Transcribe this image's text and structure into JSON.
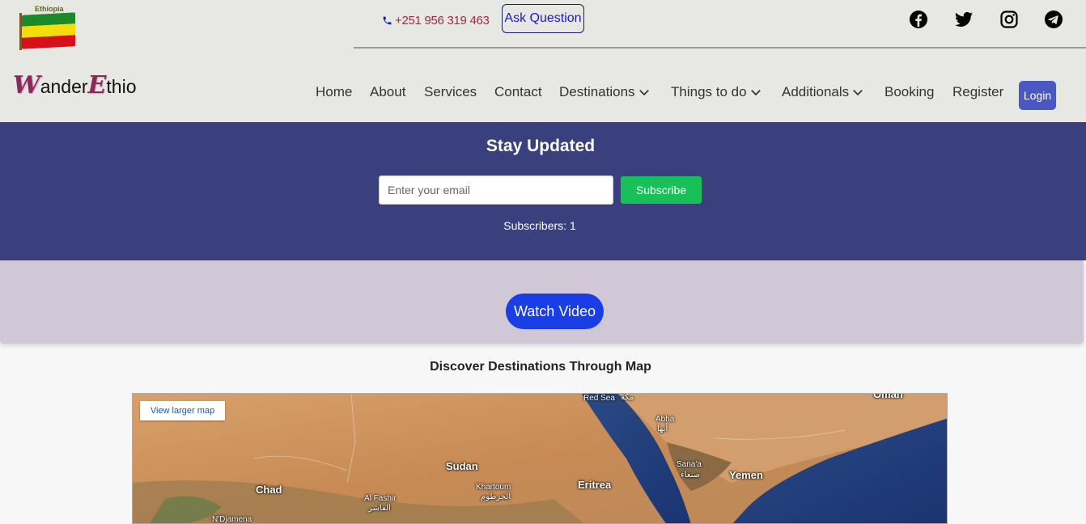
{
  "header": {
    "flag_label": "Ethiopia",
    "phone": "+251 956 319 463",
    "ask_button": "Ask Question",
    "social": [
      "facebook-icon",
      "twitter-icon",
      "instagram-icon",
      "telegram-icon"
    ],
    "logo": {
      "first_letter": "W",
      "middle": "ander",
      "second_letter": "E",
      "end": "thio"
    }
  },
  "nav": {
    "items": [
      {
        "label": "Home",
        "dropdown": false
      },
      {
        "label": "About",
        "dropdown": false
      },
      {
        "label": "Services",
        "dropdown": false
      },
      {
        "label": "Contact",
        "dropdown": false
      },
      {
        "label": "Destinations",
        "dropdown": true
      },
      {
        "label": "Things to do",
        "dropdown": true
      },
      {
        "label": "Additionals",
        "dropdown": true
      },
      {
        "label": "Booking",
        "dropdown": false
      },
      {
        "label": "Register",
        "dropdown": false
      }
    ],
    "login": "Login"
  },
  "newsletter": {
    "title": "Stay Updated",
    "email_placeholder": "Enter your email",
    "subscribe": "Subscribe",
    "subscribers": "Subscribers: 1"
  },
  "video": {
    "button": "Watch Video"
  },
  "map": {
    "title": "Discover Destinations Through Map",
    "larger_map": "View larger map",
    "labels": {
      "red_sea": "Red Sea",
      "makkah": "مكة",
      "oman": "Oman",
      "abha": "Abha",
      "abha_ar": "أبها",
      "sudan": "Sudan",
      "sanaa": "Sana'a",
      "sanaa_ar": "صنعاء",
      "yemen": "Yemen",
      "chad": "Chad",
      "khartoum": "Khartoum",
      "khartoum_ar": "الخرطوم",
      "eritrea": "Eritrea",
      "al_fashir": "Al Fashir",
      "al_fashir_ar": "الفاشر",
      "ndjamena": "N'Djamena"
    }
  },
  "colors": {
    "header_bg": "#e7e8e4",
    "newsletter_bg": "#3a407e",
    "subscribe_green": "#18c05a",
    "login_blue": "#4a58c2",
    "watch_blue": "#1a3ee6"
  }
}
